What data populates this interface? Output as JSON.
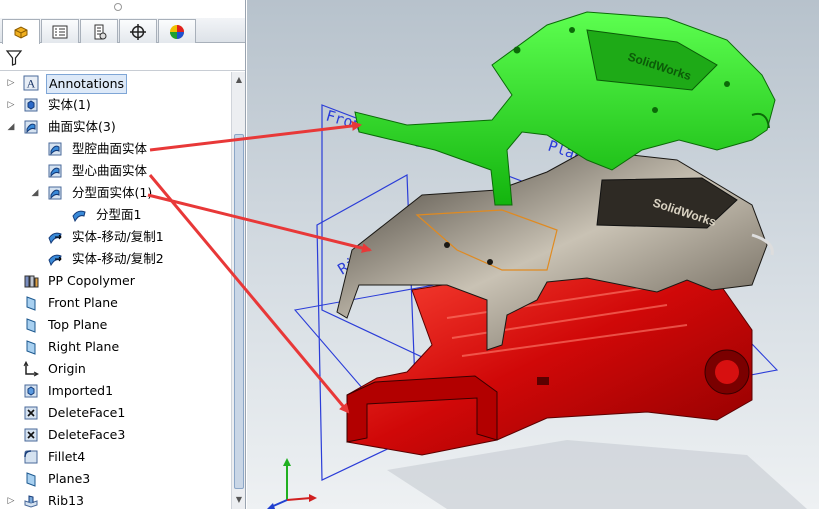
{
  "feature_tree": {
    "items": [
      {
        "label": "Annotations",
        "icon": "annotations-icon",
        "expander": "right",
        "indent": 0,
        "selected": true
      },
      {
        "label": "实体(1)",
        "icon": "solid-bodies-icon",
        "expander": "right",
        "indent": 0
      },
      {
        "label": "曲面实体(3)",
        "icon": "surface-bodies-icon",
        "expander": "down",
        "indent": 0
      },
      {
        "label": "型腔曲面实体",
        "icon": "surface-body-icon",
        "expander": "",
        "indent": 1
      },
      {
        "label": "型心曲面实体",
        "icon": "surface-body-icon",
        "expander": "",
        "indent": 1
      },
      {
        "label": "分型面实体(1)",
        "icon": "surface-body-icon",
        "expander": "down",
        "indent": 1
      },
      {
        "label": "分型面1",
        "icon": "parting-surface-icon",
        "expander": "",
        "indent": 2
      },
      {
        "label": "实体-移动/复制1",
        "icon": "move-copy-icon",
        "expander": "",
        "indent": 1
      },
      {
        "label": "实体-移动/复制2",
        "icon": "move-copy-icon",
        "expander": "",
        "indent": 1
      },
      {
        "label": "PP Copolymer",
        "icon": "material-icon",
        "expander": "",
        "indent": 0
      },
      {
        "label": "Front Plane",
        "icon": "plane-icon",
        "expander": "",
        "indent": 0
      },
      {
        "label": "Top Plane",
        "icon": "plane-icon",
        "expander": "",
        "indent": 0
      },
      {
        "label": "Right Plane",
        "icon": "plane-icon",
        "expander": "",
        "indent": 0
      },
      {
        "label": "Origin",
        "icon": "origin-icon",
        "expander": "",
        "indent": 0
      },
      {
        "label": "Imported1",
        "icon": "imported-icon",
        "expander": "",
        "indent": 0
      },
      {
        "label": "DeleteFace1",
        "icon": "delete-face-icon",
        "expander": "",
        "indent": 0
      },
      {
        "label": "DeleteFace3",
        "icon": "delete-face-icon",
        "expander": "",
        "indent": 0
      },
      {
        "label": "Fillet4",
        "icon": "fillet-icon",
        "expander": "",
        "indent": 0
      },
      {
        "label": "Plane3",
        "icon": "plane-icon",
        "expander": "",
        "indent": 0
      },
      {
        "label": "Rib13",
        "icon": "rib-icon",
        "expander": "right",
        "indent": 0
      }
    ]
  },
  "tabs": [
    {
      "name": "feature-manager-tab",
      "icon": "feature-manager-icon"
    },
    {
      "name": "property-manager-tab",
      "icon": "property-manager-icon"
    },
    {
      "name": "configuration-manager-tab",
      "icon": "configuration-manager-icon"
    },
    {
      "name": "dimxpert-tab",
      "icon": "crosshair-icon"
    },
    {
      "name": "appearance-tab",
      "icon": "appearance-icon"
    }
  ],
  "viewport": {
    "plane_labels": [
      "Front Plane",
      "Right Plane",
      "Plane"
    ],
    "logo_text": "SolidWorks",
    "colors": {
      "cavity": "#22dd1a",
      "parting": "#6e6658",
      "core": "#e01010",
      "plane": "#2b3dd8",
      "arrow": "#e83838"
    }
  }
}
